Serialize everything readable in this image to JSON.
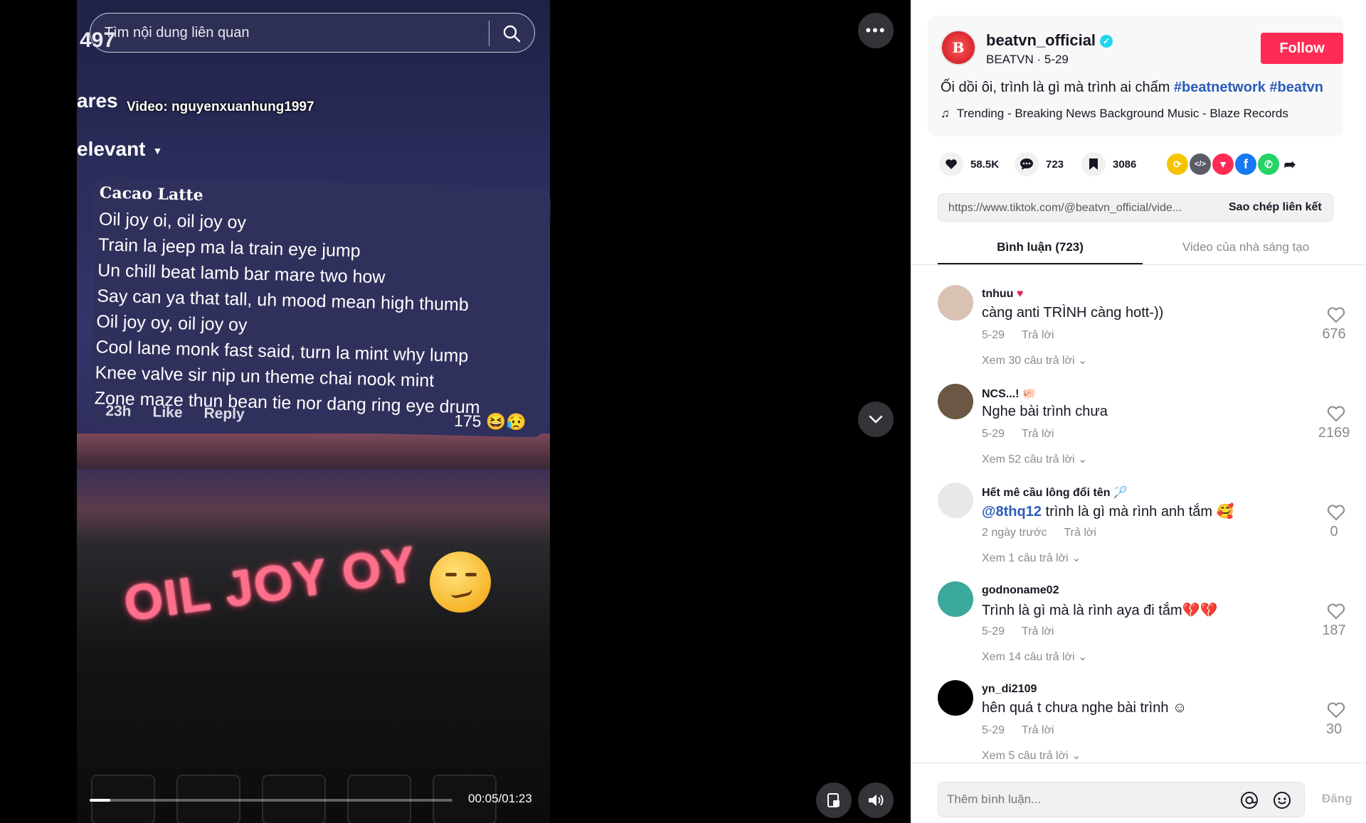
{
  "video": {
    "search_placeholder": "Tìm nội dung liên quan",
    "view_number": "497",
    "shares_label": "ares",
    "credit": "Video: nguyenxuanhung1997",
    "relevant_label": "elevant",
    "card": {
      "author": "Cacao Latte",
      "lyrics": [
        "Oil joy oi, oil joy oy",
        "Train la jeep ma la train eye jump",
        "Un chill beat lamb bar mare two how",
        "Say can ya that tall, uh mood mean high thumb",
        "Oil joy oy, oil joy oy",
        "Cool lane monk fast said, turn la mint why lump",
        "Knee valve sir nip un theme chai nook mint",
        "Zone maze thun bean tie nor dang ring eye drum"
      ],
      "time": "23h",
      "like": "Like",
      "reply": "Reply",
      "likes": "175"
    },
    "overlay_text": "OIL JOY OY",
    "progress": 0.057,
    "time": "00:05/01:23"
  },
  "post": {
    "username": "beatvn_official",
    "display": "BEATVN · 5-29",
    "avatar_letter": "B",
    "follow_label": "Follow",
    "caption": "Ối dồi ôi, trình là gì mà trình ai chấm ",
    "tags": [
      "#beatnetwork",
      "#beatvn"
    ],
    "music": "Trending - Breaking News Background Music - Blaze Records",
    "likes": "58.5K",
    "comments": "723",
    "saves": "3086",
    "link": "https://www.tiktok.com/@beatvn_official/vide...",
    "copy_label": "Sao chép liên kết"
  },
  "tabs": {
    "comments": "Bình luận (723)",
    "creator": "Video của nhà sáng tạo"
  },
  "comments": [
    {
      "name": "tnhuu",
      "text": "càng anti TRÌNH càng hott-))",
      "date": "5-29",
      "reply": "Trả lời",
      "more": "Xem 30 câu trả lời",
      "likes": "676",
      "avatar_color": "#d9c2b4"
    },
    {
      "name": "NCS...!",
      "text": "Nghe bài trình chưa",
      "date": "5-29",
      "reply": "Trả lời",
      "more": "Xem 52 câu trả lời",
      "likes": "2169",
      "avatar_color": "#6b5744"
    },
    {
      "name": "Hết mê cầu lông đổi tên",
      "mention": "@8thq12",
      "text": "trình là gì mà rình anh tắm",
      "date": "2 ngày trước",
      "reply": "Trả lời",
      "more": "Xem 1 câu trả lời",
      "likes": "0",
      "avatar_color": "#e8e8e8"
    },
    {
      "name": "godnoname02",
      "text": "Trình là gì mà là rình aya đi tắm",
      "date": "5-29",
      "reply": "Trả lời",
      "more": "Xem 14 câu trả lời",
      "likes": "187",
      "avatar_color": "#3aa89a"
    },
    {
      "name": "yn_di2109",
      "text": "hên quá t chưa nghe bài trình",
      "date": "5-29",
      "reply": "Trả lời",
      "more": "Xem 5 câu trả lời",
      "likes": "30",
      "avatar_color": "#000000"
    }
  ],
  "composer": {
    "placeholder": "Thêm bình luận...",
    "post_label": "Đăng"
  },
  "colors": {
    "accent": "#fe2c55",
    "hashtag": "#2b5db9",
    "verified": "#20d5ec"
  },
  "icons": {
    "share_row": [
      "repost-icon",
      "embed-icon",
      "send-icon",
      "facebook-icon",
      "whatsapp-icon",
      "share-arrow-icon"
    ]
  }
}
